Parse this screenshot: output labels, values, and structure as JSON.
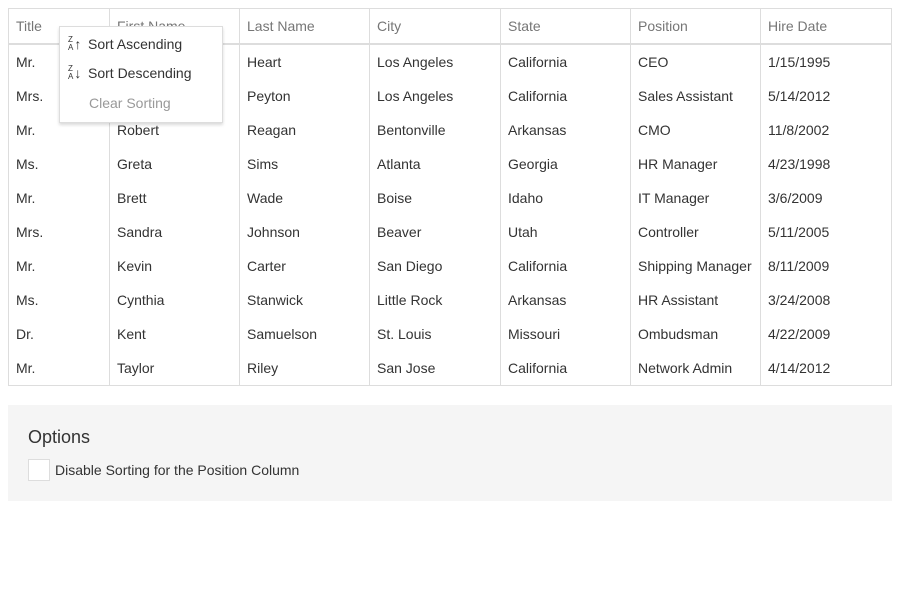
{
  "columns": [
    "Title",
    "First Name",
    "Last Name",
    "City",
    "State",
    "Position",
    "Hire Date"
  ],
  "rows": [
    [
      "Mr.",
      "",
      "Heart",
      "Los Angeles",
      "California",
      "CEO",
      "1/15/1995"
    ],
    [
      "Mrs.",
      "",
      "Peyton",
      "Los Angeles",
      "California",
      "Sales Assistant",
      "5/14/2012"
    ],
    [
      "Mr.",
      "Robert",
      "Reagan",
      "Bentonville",
      "Arkansas",
      "CMO",
      "11/8/2002"
    ],
    [
      "Ms.",
      "Greta",
      "Sims",
      "Atlanta",
      "Georgia",
      "HR Manager",
      "4/23/1998"
    ],
    [
      "Mr.",
      "Brett",
      "Wade",
      "Boise",
      "Idaho",
      "IT Manager",
      "3/6/2009"
    ],
    [
      "Mrs.",
      "Sandra",
      "Johnson",
      "Beaver",
      "Utah",
      "Controller",
      "5/11/2005"
    ],
    [
      "Mr.",
      "Kevin",
      "Carter",
      "San Diego",
      "California",
      "Shipping Manager",
      "8/11/2009"
    ],
    [
      "Ms.",
      "Cynthia",
      "Stanwick",
      "Little Rock",
      "Arkansas",
      "HR Assistant",
      "3/24/2008"
    ],
    [
      "Dr.",
      "Kent",
      "Samuelson",
      "St. Louis",
      "Missouri",
      "Ombudsman",
      "4/22/2009"
    ],
    [
      "Mr.",
      "Taylor",
      "Riley",
      "San Jose",
      "California",
      "Network Admin",
      "4/14/2012"
    ]
  ],
  "menu": {
    "sort_ascending": "Sort Ascending",
    "sort_descending": "Sort Descending",
    "clear_sorting": "Clear Sorting",
    "icon_letters": "ZA"
  },
  "options": {
    "title": "Options",
    "checkbox_label": "Disable Sorting for the Position Column",
    "checked": false
  }
}
